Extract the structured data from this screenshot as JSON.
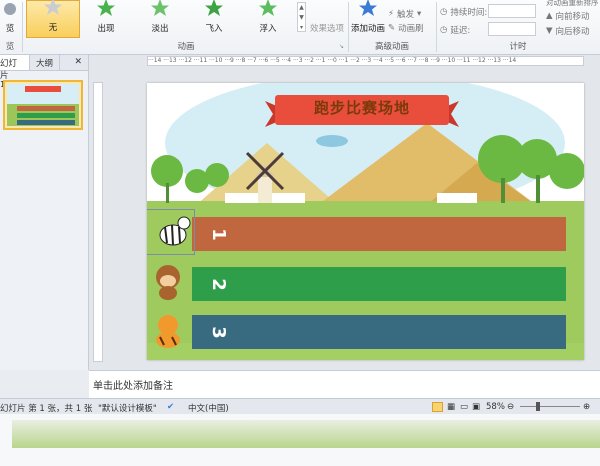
{
  "ribbon": {
    "preview_fragment": "览",
    "preview_group_fragment": "览",
    "effects": [
      {
        "label": "无",
        "icon": "star-icon"
      },
      {
        "label": "出现",
        "icon": "star-icon"
      },
      {
        "label": "淡出",
        "icon": "star-icon"
      },
      {
        "label": "飞入",
        "icon": "star-icon"
      },
      {
        "label": "浮入",
        "icon": "star-icon"
      }
    ],
    "effect_options": "效果选项",
    "animation_group": "动画",
    "add_animation": "添加动画",
    "trigger": "触发",
    "animation_painter": "动画刷",
    "advanced_group": "高级动画",
    "duration_label": "持续时间:",
    "delay_label": "延迟:",
    "timing_group": "计时",
    "reorder_title": "对动画重新排序",
    "move_earlier": "向前移动",
    "move_later": "向后移动"
  },
  "left_panel": {
    "tab_slides": "幻灯片",
    "tab_outline": "大纲",
    "close_glyph": "✕",
    "thumb_number": "1"
  },
  "slide": {
    "title": "跑步比赛场地",
    "lanes": [
      {
        "label": "1",
        "color": "#c0673f"
      },
      {
        "label": "2",
        "color": "#2e9e4a"
      },
      {
        "label": "3",
        "color": "#386a80"
      }
    ]
  },
  "notes_placeholder": "单击此处添加备注",
  "status": {
    "slide_info": "幻灯片 第 1 张，共 1 张",
    "theme": "\"默认设计模板\"",
    "language": "中文(中国)",
    "zoom": "58%"
  },
  "colors": {
    "accent": "#f0b636",
    "ribbon_banner": "#e94e3c"
  }
}
